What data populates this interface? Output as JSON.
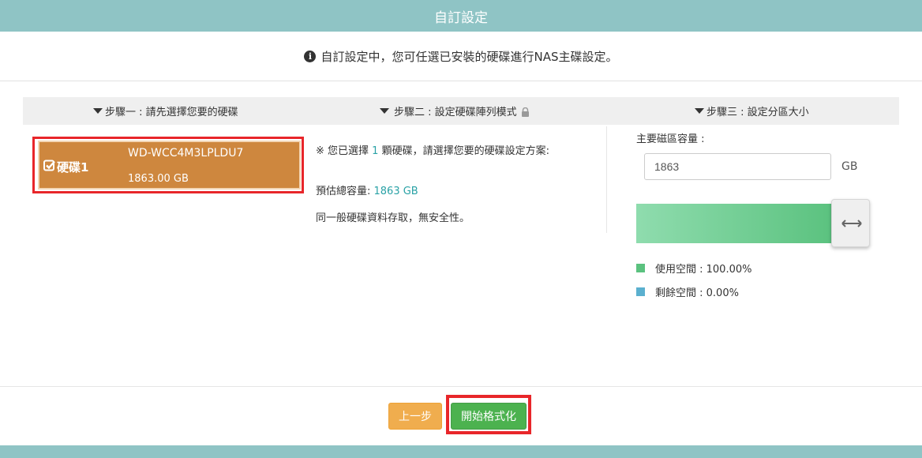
{
  "dialog": {
    "title": "自訂設定",
    "info_text": "自訂設定中，您可任選已安裝的硬碟進行NAS主碟設定。"
  },
  "steps": [
    {
      "label": "步驟一 : 請先選擇您要的硬碟"
    },
    {
      "label": "步驟二 : 設定硬碟陣列模式"
    },
    {
      "label": "步驟三 : 設定分區大小"
    }
  ],
  "disk": {
    "name": "硬碟1",
    "model": "WD-WCC4M3LPLDU7",
    "size": "1863.00 GB",
    "selected": true
  },
  "raid": {
    "selected_prefix": "※ 您已選擇 ",
    "selected_count": "1",
    "selected_suffix": " 顆硬碟，請選擇您要的硬碟設定方案:",
    "capacity_label": "預估總容量: ",
    "capacity_value": "1863 GB",
    "mode_desc": "同一般硬碟資料存取，無安全性。"
  },
  "partition": {
    "label": "主要磁區容量 :",
    "input_value": "1863",
    "unit": "GB",
    "used_fraction": 1.0,
    "legend_used": "使用空間 : 100.00%",
    "legend_free": "剩餘空間 : 0.00%",
    "used_color": "#5bc27f",
    "free_color": "#5bb0cf"
  },
  "footer": {
    "prev_label": "上一步",
    "start_label": "開始格式化"
  },
  "colors": {
    "header": "#8fc4c5",
    "disk_selected": "#ce873e",
    "highlight": "#e8262a",
    "prev_button": "#f0ad4e",
    "start_button": "#4cb24f"
  }
}
